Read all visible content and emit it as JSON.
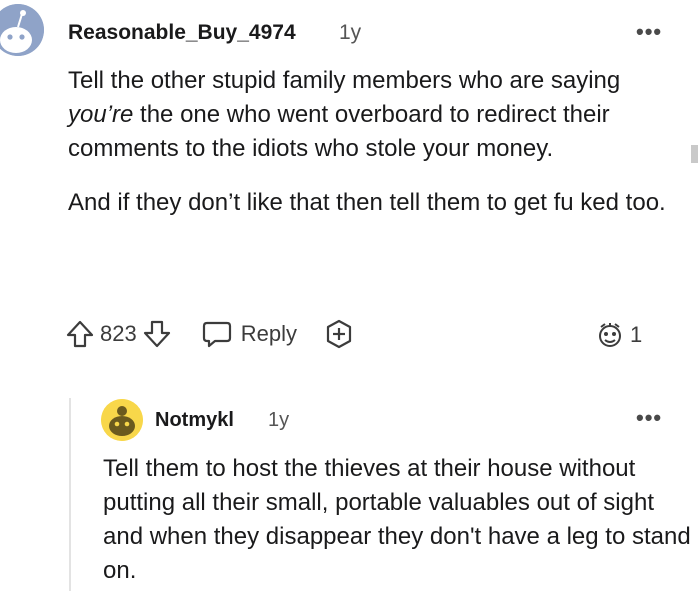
{
  "comment": {
    "author": "Reasonable_Buy_4974",
    "age": "1y",
    "more_label": "•••",
    "body_parts": {
      "p1_before": "Tell the other stupid family members who are saying ",
      "p1_em": "you’re",
      "p1_after": " the one who went overboard to redirect their comments to the idiots who stole your money.",
      "p2": "And if they don’t like that then tell them to get fu ked too."
    },
    "score": "823",
    "reply_label": "Reply",
    "award_count": "1",
    "icons": {
      "avatar": "snoo-avatar-icon",
      "upvote": "upvote-arrow-icon",
      "downvote": "downvote-arrow-icon",
      "reply": "speech-bubble-icon",
      "add_award": "plus-circle-icon",
      "award": "award-face-icon"
    }
  },
  "reply": {
    "author": "Notmykl",
    "age": "1y",
    "more_label": "•••",
    "body": "Tell them to host the thieves at their house without putting all their small, portable valuables out of sight and when they disappear they don't have a leg to stand on."
  },
  "colors": {
    "text": "#1a1a1b",
    "meta": "#555555",
    "avatar_blue": "#8fa3c8",
    "avatar_yellow": "#f8d74a",
    "thread_line": "#e3e3e3"
  }
}
